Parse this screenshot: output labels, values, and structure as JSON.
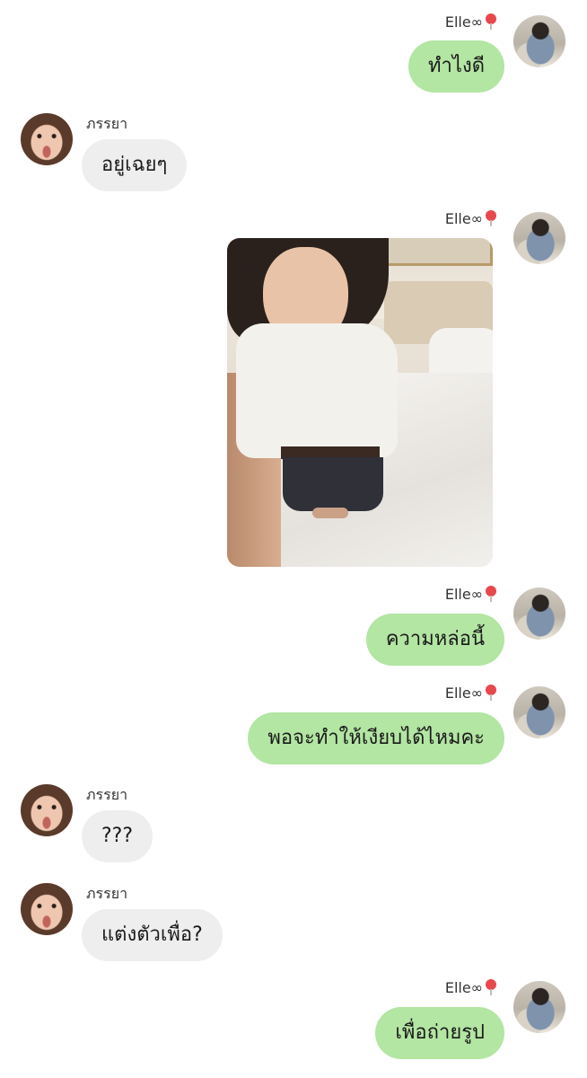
{
  "chat": {
    "messages": [
      {
        "sender": "Elle∞",
        "text": "ทำไงดี"
      },
      {
        "sender": "ภรรยา",
        "text": "อยู่เฉยๆ"
      },
      {
        "sender": "Elle∞",
        "type": "image"
      },
      {
        "sender": "Elle∞",
        "text": "ความหล่อนี้"
      },
      {
        "sender": "Elle∞",
        "text": "พอจะทำให้เงียบได้ไหมคะ"
      },
      {
        "sender": "ภรรยา",
        "text": "???"
      },
      {
        "sender": "ภรรยา",
        "text": "แต่งตัวเพื่อ?"
      },
      {
        "sender": "Elle∞",
        "text": "เพื่อถ่ายรูป"
      }
    ]
  },
  "colors": {
    "my_bubble": "#b3e5a3",
    "their_bubble": "#eeeeee",
    "balloon": "#e8474d"
  },
  "icons": {
    "sender_badge": "red-balloon-icon"
  }
}
